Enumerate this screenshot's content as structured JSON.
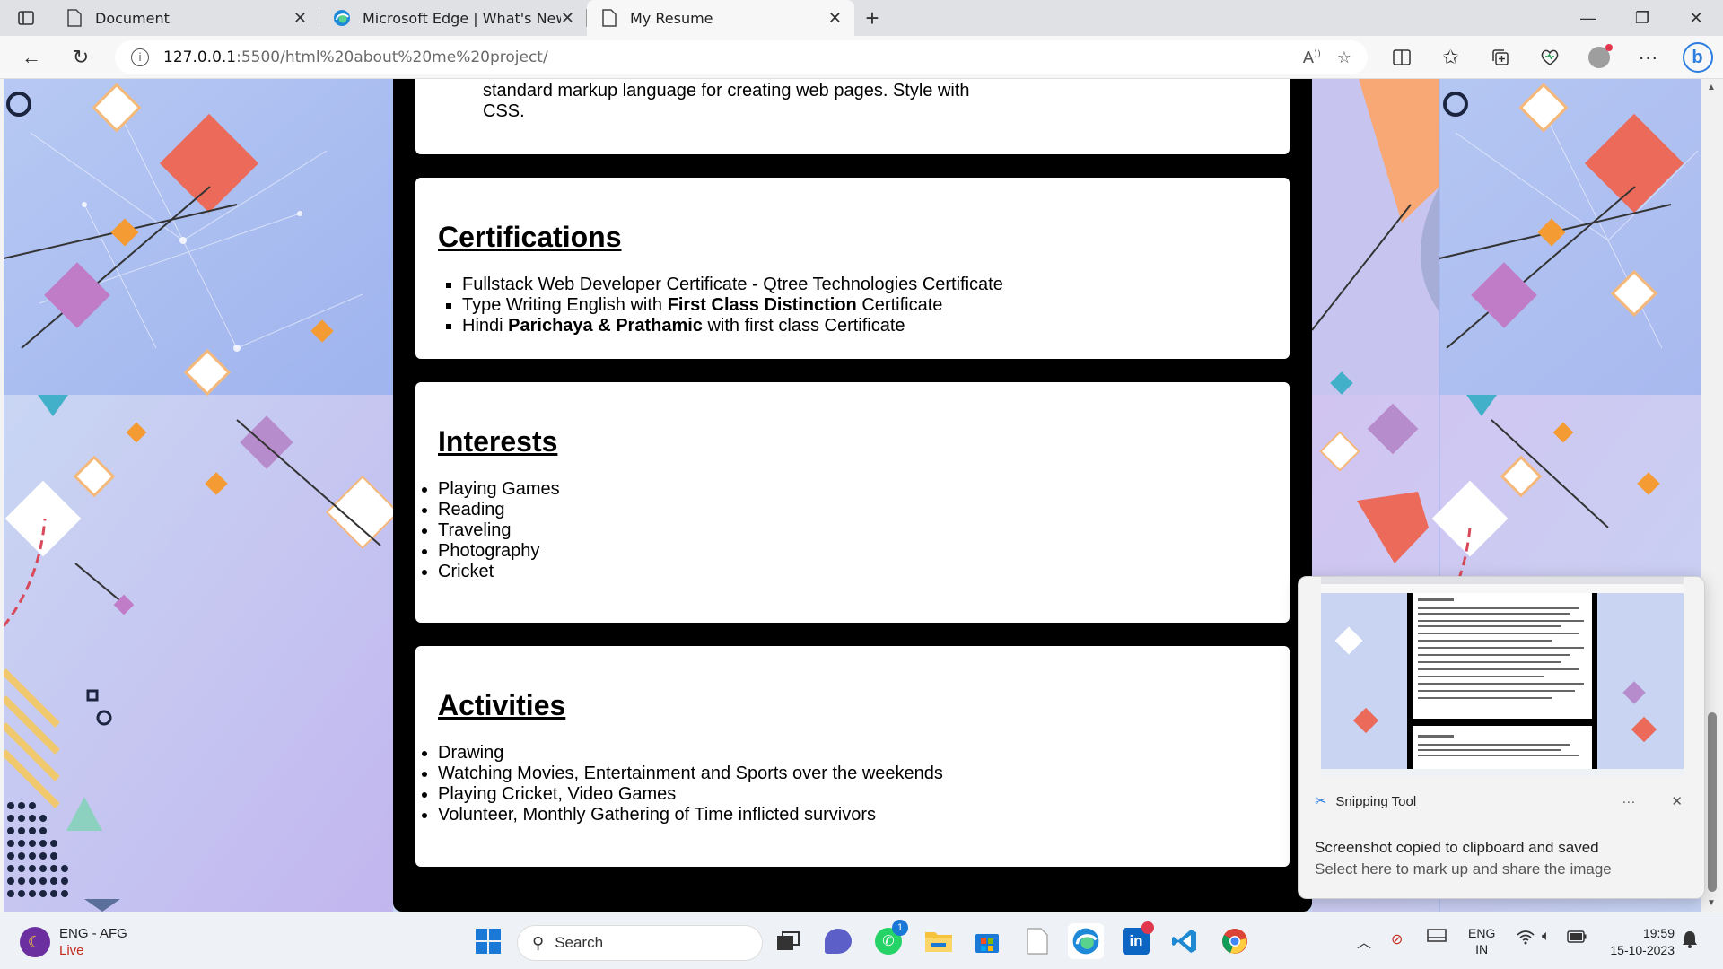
{
  "browser": {
    "tabs": [
      {
        "title": "Document",
        "icon": "page-icon"
      },
      {
        "title": "Microsoft Edge | What's New",
        "icon": "edge-icon"
      },
      {
        "title": "My Resume",
        "icon": "page-icon",
        "active": true
      }
    ],
    "address": {
      "host": "127.0.0.1",
      "path": ":5500/html%20about%20me%20project/"
    }
  },
  "resume": {
    "prev_text_line1": "standard markup language for creating web pages. Style with",
    "prev_text_line2": "CSS.",
    "certifications": {
      "heading": "Certifications",
      "items": [
        {
          "pre": "Fullstack Web Developer Certificate - Qtree Technologies Certificate",
          "bold": "",
          "post": ""
        },
        {
          "pre": "Type Writing English with ",
          "bold": "First Class Distinction",
          "post": " Certificate"
        },
        {
          "pre": "Hindi ",
          "bold": "Parichaya & Prathamic",
          "post": " with first class Certificate"
        }
      ]
    },
    "interests": {
      "heading": "Interests",
      "items": [
        "Playing Games",
        "Reading",
        "Traveling",
        "Photography",
        "Cricket"
      ]
    },
    "activities": {
      "heading": "Activities",
      "items": [
        "Drawing",
        "Watching Movies, Entertainment and Sports over the weekends",
        "Playing Cricket, Video Games",
        "Volunteer, Monthly Gathering of Time inflicted survivors"
      ]
    }
  },
  "toast": {
    "app_name": "Snipping Tool",
    "title": "Screenshot copied to clipboard and saved",
    "subtitle": "Select here to mark up and share the image"
  },
  "taskbar": {
    "weather_lang": "ENG - AFG",
    "weather_live": "Live",
    "search_placeholder": "Search",
    "whatsapp_badge": "1",
    "lang_top": "ENG",
    "lang_bottom": "IN",
    "time": "19:59",
    "date": "15-10-2023"
  }
}
